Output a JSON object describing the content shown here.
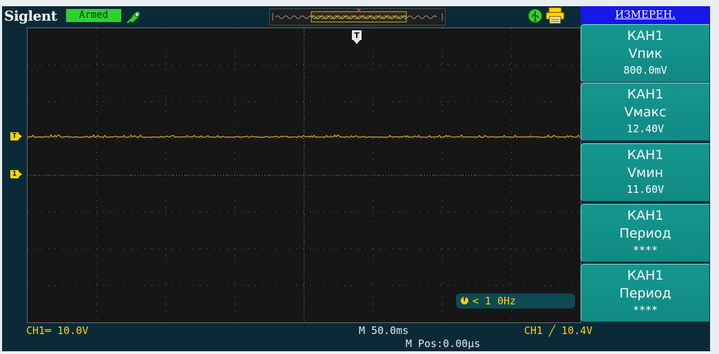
{
  "header": {
    "brand": "Siglent",
    "status": "Armed",
    "icons": {
      "acquire": "probe-icon",
      "usb": "usb-icon",
      "printer": "printer-icon"
    }
  },
  "markers": {
    "trigger_position": "T",
    "trigger_level": "T",
    "channel1": "1"
  },
  "frequency_counter": {
    "icon": "f",
    "text": "< 1 0Hz"
  },
  "bottom_bar": {
    "ch1_scale": "CH1═ 10.0V",
    "timebase": "M 50.0ms",
    "m_pos": "M Pos:0.00μs",
    "trigger": "CH1 ╱ 10.4V"
  },
  "menu": {
    "title": "ИЗМЕРЕН.",
    "items": [
      {
        "source": "КАН1",
        "type": "Vпик",
        "value": "800.0mV"
      },
      {
        "source": "КАН1",
        "type": "Vмакс",
        "value": "12.40V"
      },
      {
        "source": "КАН1",
        "type": "Vмин",
        "value": "11.60V"
      },
      {
        "source": "КАН1",
        "type": "Период",
        "value": "****"
      },
      {
        "source": "КАН1",
        "type": "Период",
        "value": "****"
      }
    ]
  },
  "colors": {
    "frame": "#0b2a38",
    "grid_background": "#161616",
    "trace": "#b8a232",
    "channel1": "#ffd400",
    "status_armed": "#2fd12f",
    "menu_title": "#1717e8",
    "menu_item": "#14978f"
  }
}
